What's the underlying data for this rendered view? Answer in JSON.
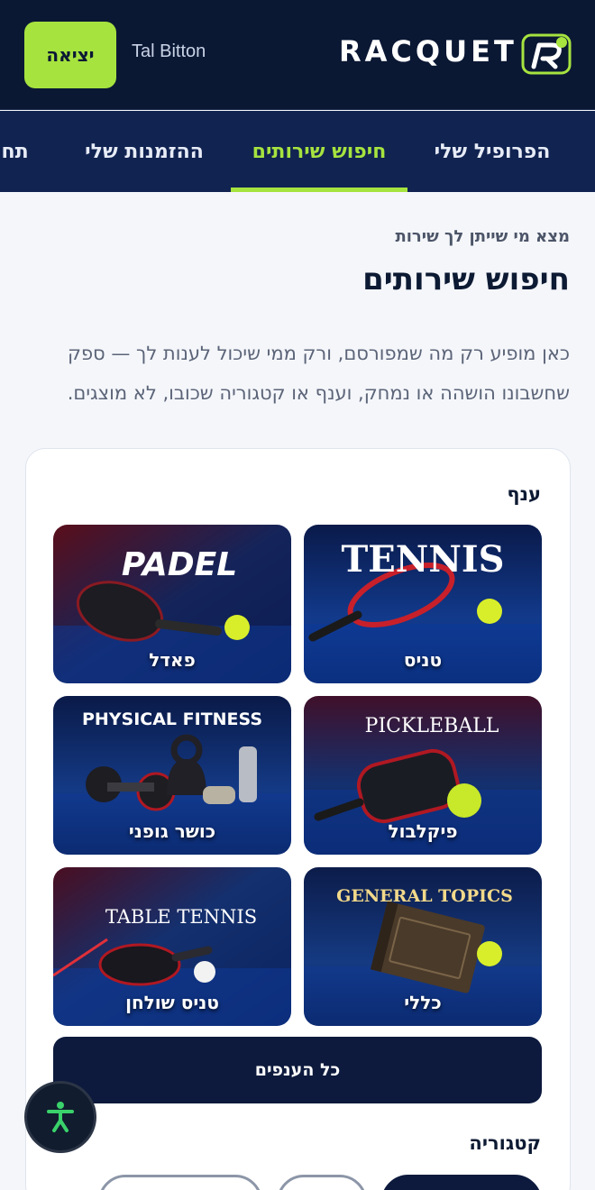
{
  "header": {
    "logout_label": "יציאה",
    "username": "Tal Bitton",
    "brand_name": "RACQUET",
    "colors": {
      "bg": "#0b1834",
      "accent": "#a6e33f"
    }
  },
  "tabs": [
    {
      "label": "הפרופיל שלי",
      "active": false
    },
    {
      "label": "חיפוש שירותים",
      "active": true
    },
    {
      "label": "ההזמנות שלי",
      "active": false
    },
    {
      "label": "תחו",
      "active": false
    }
  ],
  "page": {
    "eyebrow": "מצא מי שייתן לך שירות",
    "title": "חיפוש שירותים",
    "description": "כאן מופיע רק מה שמפורסם, ורק ממי שיכול לענות לך — ספק שחשבונו הושהה או נמחק, וענף או קטגוריה שכובו, לא מוצגים."
  },
  "branch_section": {
    "label": "ענף",
    "tiles": [
      {
        "label": "טניס",
        "image_text": "TENNIS",
        "icon": "tennis-racquet-icon"
      },
      {
        "label": "פאדל",
        "image_text": "PADEL",
        "icon": "padel-racquet-icon"
      },
      {
        "label": "פיקלבול",
        "image_text": "PICKLEBALL",
        "icon": "pickleball-paddle-icon"
      },
      {
        "label": "כושר גופני",
        "image_text": "PHYSICAL FITNESS",
        "icon": "dumbbell-icon"
      },
      {
        "label": "כללי",
        "image_text": "GENERAL TOPICS",
        "icon": "book-icon"
      },
      {
        "label": "טניס שולחן",
        "image_text": "TABLE TENNIS",
        "icon": "ping-pong-paddle-icon"
      }
    ],
    "all_button_label": "כל הענפים"
  },
  "category_section": {
    "label": "קטגוריה"
  }
}
